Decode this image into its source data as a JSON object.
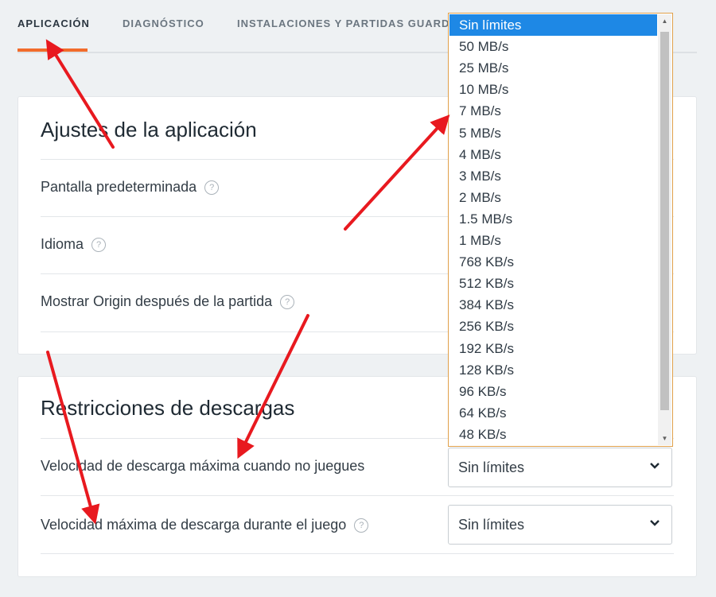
{
  "tabs": [
    {
      "label": "APLICACIÓN"
    },
    {
      "label": "DIAGNÓSTICO"
    },
    {
      "label": "INSTALACIONES Y PARTIDAS GUARDA"
    }
  ],
  "app_settings": {
    "title": "Ajustes de la aplicación",
    "rows": [
      {
        "label": "Pantalla predeterminada"
      },
      {
        "label": "Idioma"
      },
      {
        "label": "Mostrar Origin después de la partida"
      }
    ]
  },
  "download_restrictions": {
    "title": "Restricciones de descargas",
    "rows": [
      {
        "label": "Velocidad de descarga máxima cuando no juegues",
        "value": "Sin límites"
      },
      {
        "label": "Velocidad máxima de descarga durante el juego",
        "value": "Sin límites"
      }
    ]
  },
  "help_glyph": "?",
  "dropdown": {
    "selected": "Sin límites",
    "options": [
      "Sin límites",
      "50 MB/s",
      "25 MB/s",
      "10 MB/s",
      "7 MB/s",
      "5 MB/s",
      "4 MB/s",
      "3 MB/s",
      "2 MB/s",
      "1.5 MB/s",
      "1 MB/s",
      "768 KB/s",
      "512 KB/s",
      "384 KB/s",
      "256 KB/s",
      "192 KB/s",
      "128 KB/s",
      "96 KB/s",
      "64 KB/s",
      "48 KB/s"
    ]
  },
  "colors": {
    "accent": "#f26c2b",
    "selection": "#1e88e5",
    "annotation_arrow": "#e8191f"
  }
}
